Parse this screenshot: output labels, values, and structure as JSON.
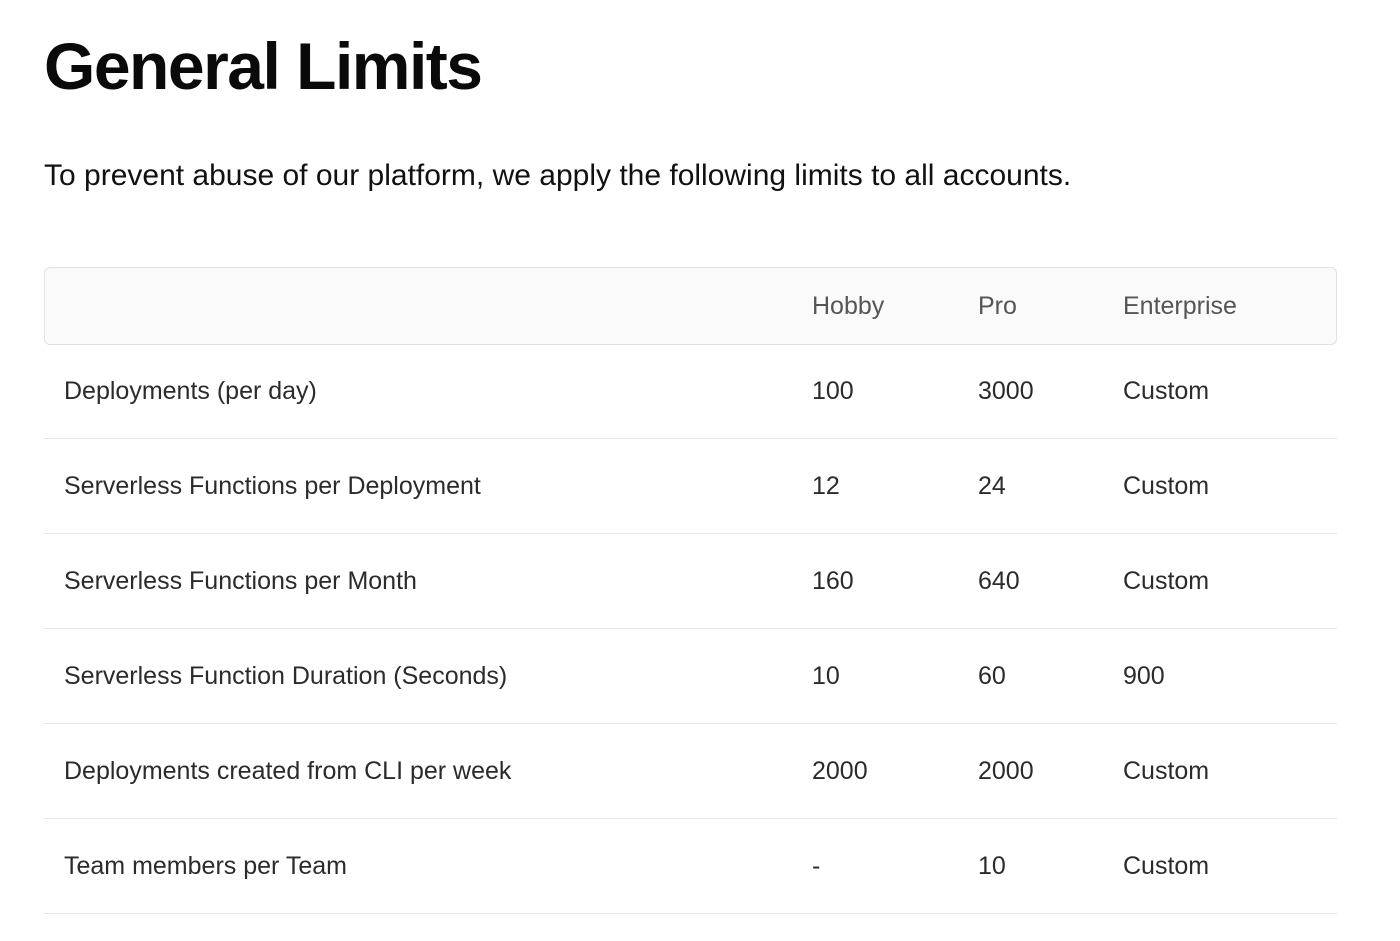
{
  "heading": "General Limits",
  "intro": "To prevent abuse of our platform, we apply the following limits to all accounts.",
  "table": {
    "headers": [
      "",
      "Hobby",
      "Pro",
      "Enterprise"
    ],
    "rows": [
      [
        "Deployments (per day)",
        "100",
        "3000",
        "Custom"
      ],
      [
        "Serverless Functions per Deployment",
        "12",
        "24",
        "Custom"
      ],
      [
        "Serverless Functions per Month",
        "160",
        "640",
        "Custom"
      ],
      [
        "Serverless Function Duration (Seconds)",
        "10",
        "60",
        "900"
      ],
      [
        "Deployments created from CLI per week",
        "2000",
        "2000",
        "Custom"
      ],
      [
        "Team members per Team",
        "-",
        "10",
        "Custom"
      ]
    ]
  }
}
